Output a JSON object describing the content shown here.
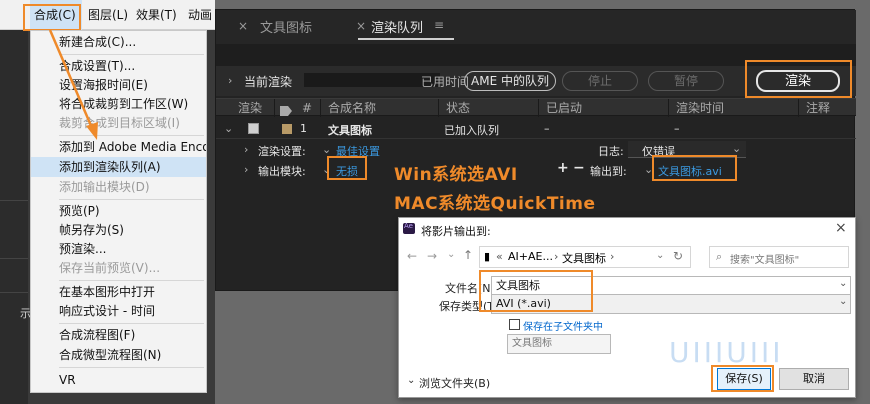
{
  "menubar": {
    "items": [
      "合成(C)",
      "图层(L)",
      "效果(T)",
      "动画"
    ]
  },
  "composition_menu": {
    "items": [
      {
        "label": "新建合成(C)...",
        "disabled": false
      },
      {
        "label": "合成设置(T)...",
        "disabled": false
      },
      {
        "label": "设置海报时间(E)",
        "disabled": false
      },
      {
        "label": "将合成裁剪到工作区(W)",
        "disabled": false
      },
      {
        "label": "裁剪合成到目标区域(I)",
        "disabled": true
      },
      {
        "label": "添加到 Adobe Media Encoder 队列...",
        "disabled": false
      },
      {
        "label": "添加到渲染队列(A)",
        "disabled": false,
        "highlighted": true
      },
      {
        "label": "添加输出模块(D)",
        "disabled": true
      },
      {
        "label": "预览(P)",
        "disabled": false
      },
      {
        "label": "帧另存为(S)",
        "disabled": false
      },
      {
        "label": "预渲染...",
        "disabled": false
      },
      {
        "label": "保存当前预览(V)...",
        "disabled": true
      },
      {
        "label": "在基本图形中打开",
        "disabled": false
      },
      {
        "label": "响应式设计 - 时间",
        "disabled": false
      },
      {
        "label": "合成流程图(F)",
        "disabled": false
      },
      {
        "label": "合成微型流程图(N)",
        "disabled": false
      },
      {
        "label": "VR",
        "disabled": false
      }
    ]
  },
  "render_queue": {
    "tabs": [
      {
        "label": "文具图标",
        "close": "×"
      },
      {
        "label": "渲染队列",
        "close": "×",
        "menu": "≡"
      }
    ],
    "current_render_label": "当前渲染",
    "elapsed_label": "已用时间",
    "ame_button": "AME 中的队列",
    "stop_button": "停止",
    "pause_button": "暂停",
    "render_button": "渲染",
    "columns": [
      "渲染",
      "#",
      "合成名称",
      "状态",
      "已启动",
      "渲染时间",
      "注释"
    ],
    "item": {
      "number": "1",
      "comp_name": "文具图标",
      "status": "已加入队列",
      "started": "–",
      "render_time": "–",
      "render_settings_label": "渲染设置:",
      "render_settings_value": "最佳设置",
      "log_label": "日志:",
      "log_value": "仅错误",
      "output_module_label": "输出模块:",
      "output_module_value": "无损",
      "output_to_label": "输出到:",
      "output_to_value": "文具图标.avi",
      "add_symbol": "+",
      "remove_symbol": "−"
    }
  },
  "annotations": {
    "win": "Win系统选AVI",
    "mac": "MAC系统选QuickTime"
  },
  "save_dialog": {
    "title": "将影片输出到:",
    "close": "×",
    "breadcrumb": [
      "«",
      "AI+AE...",
      "›",
      "文具图标",
      "›"
    ],
    "search_placeholder": "搜索\"文具图标\"",
    "filename_label": "文件名(N):",
    "filename_value": "文具图标",
    "filetype_label": "保存类型(T):",
    "filetype_value": "AVI (*.avi)",
    "subfolder_label": "保存在子文件夹中",
    "subfolder_value": "文具图标",
    "browse_label": "浏览文件夹(B)",
    "save_button": "保存(S)",
    "cancel_button": "取消",
    "watermark": "UIIIUIII"
  },
  "colors": {
    "highlight": "#ef8a2a",
    "link": "#3b9ae1",
    "menu_highlight": "#cfe3f5"
  }
}
